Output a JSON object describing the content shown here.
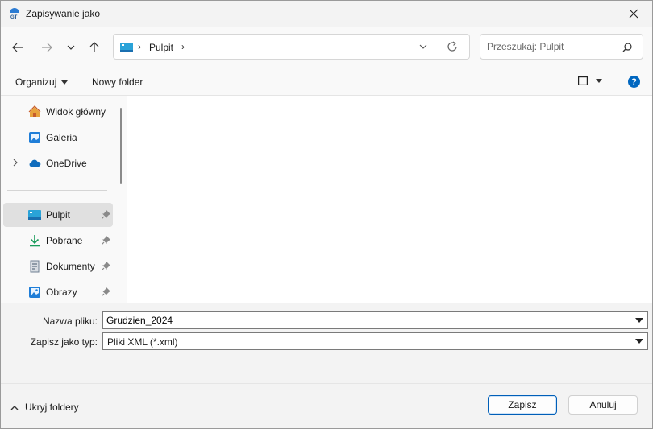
{
  "window": {
    "title": "Zapisywanie jako"
  },
  "address": {
    "folder": "Pulpit",
    "separator": "›"
  },
  "search": {
    "placeholder": "Przeszukaj: Pulpit"
  },
  "toolbar": {
    "organize_label": "Organizuj",
    "new_folder_label": "Nowy folder",
    "help_label": "?"
  },
  "sidebar": {
    "items": [
      {
        "label": "Widok główny",
        "icon": "home-icon"
      },
      {
        "label": "Galeria",
        "icon": "gallery-icon"
      },
      {
        "label": "OneDrive",
        "icon": "onedrive-icon"
      },
      {
        "label": "Pulpit",
        "icon": "desktop-icon",
        "selected": true,
        "pinned": true
      },
      {
        "label": "Pobrane",
        "icon": "download-icon",
        "pinned": true
      },
      {
        "label": "Dokumenty",
        "icon": "documents-icon",
        "pinned": true
      },
      {
        "label": "Obrazy",
        "icon": "pictures-icon",
        "pinned": true
      }
    ]
  },
  "form": {
    "filename_label": "Nazwa pliku:",
    "filename_value": "Grudzien_2024",
    "filetype_label": "Zapisz jako typ:",
    "filetype_value": "Pliki XML (*.xml)"
  },
  "footer": {
    "hide_folders_label": "Ukryj foldery",
    "save_label": "Zapisz",
    "cancel_label": "Anuluj"
  },
  "colors": {
    "accent": "#005fb8",
    "help_blue": "#0067c0",
    "selected_bg": "#e0e0e0"
  }
}
